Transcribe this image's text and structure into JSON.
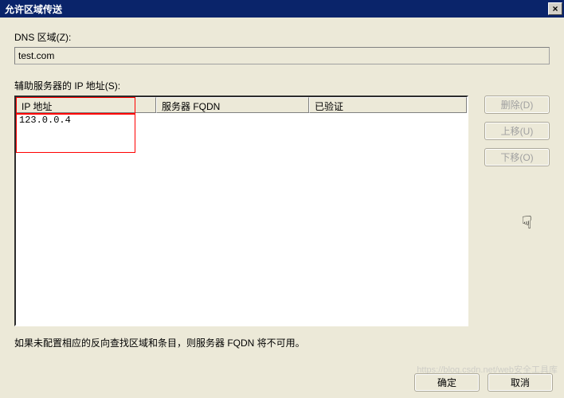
{
  "titlebar": {
    "title": "允许区域传送",
    "close": "×"
  },
  "zone": {
    "label": "DNS 区域(Z):",
    "value": "test.com"
  },
  "servers": {
    "label": "辅助服务器的 IP 地址(S):",
    "columns": {
      "ip": "IP 地址",
      "fqdn": "服务器 FQDN",
      "verified": "已验证"
    },
    "rows": [
      {
        "ip": "123.0.0.4",
        "fqdn": "",
        "verified": ""
      }
    ]
  },
  "buttons": {
    "delete": "删除(D)",
    "moveup": "上移(U)",
    "movedown": "下移(O)",
    "ok": "确定",
    "cancel": "取消"
  },
  "hint": "如果未配置相应的反向查找区域和条目，则服务器 FQDN 将不可用。",
  "watermark": "https://blog.csdn.net/web安全工具库"
}
